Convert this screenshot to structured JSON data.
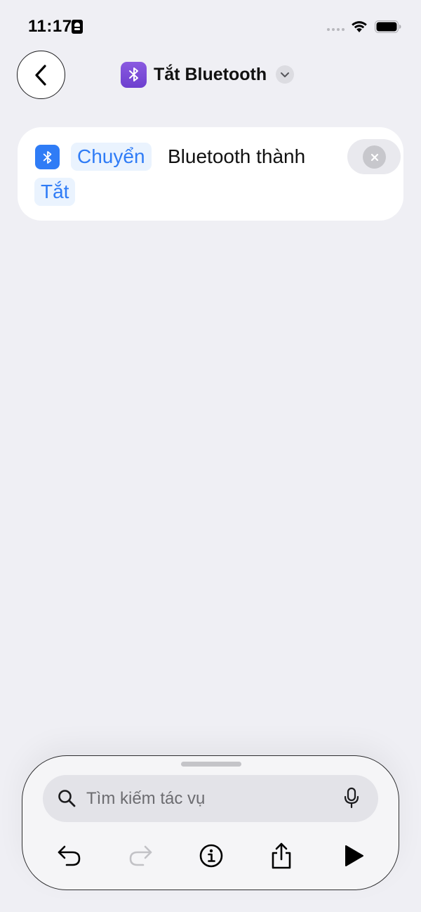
{
  "status_bar": {
    "time": "11:17",
    "icons": [
      "id-card-icon",
      "signal-dots-icon",
      "wifi-icon",
      "battery-icon"
    ]
  },
  "nav": {
    "back_icon": "chevron-left-icon",
    "app_icon": "bluetooth-icon",
    "app_icon_color": "#7a4bd8",
    "title": "Tắt Bluetooth",
    "title_menu_icon": "chevron-down-icon"
  },
  "action": {
    "icon": "bluetooth-icon",
    "icon_color": "#2f7cf6",
    "token_toggle": "Chuyển",
    "text": "Bluetooth thành",
    "token_state": "Tắt",
    "delete_icon": "close-icon"
  },
  "bottom_sheet": {
    "search": {
      "placeholder": "Tìm kiếm tác vụ",
      "value": ""
    },
    "toolbar": {
      "undo_icon": "undo-icon",
      "redo_icon": "redo-icon",
      "info_icon": "info-icon",
      "share_icon": "share-icon",
      "run_icon": "play-icon",
      "redo_enabled": false
    }
  },
  "colors": {
    "background": "#efeff4",
    "accent": "#2f7cf6",
    "token_bg": "#eaf3fe"
  }
}
